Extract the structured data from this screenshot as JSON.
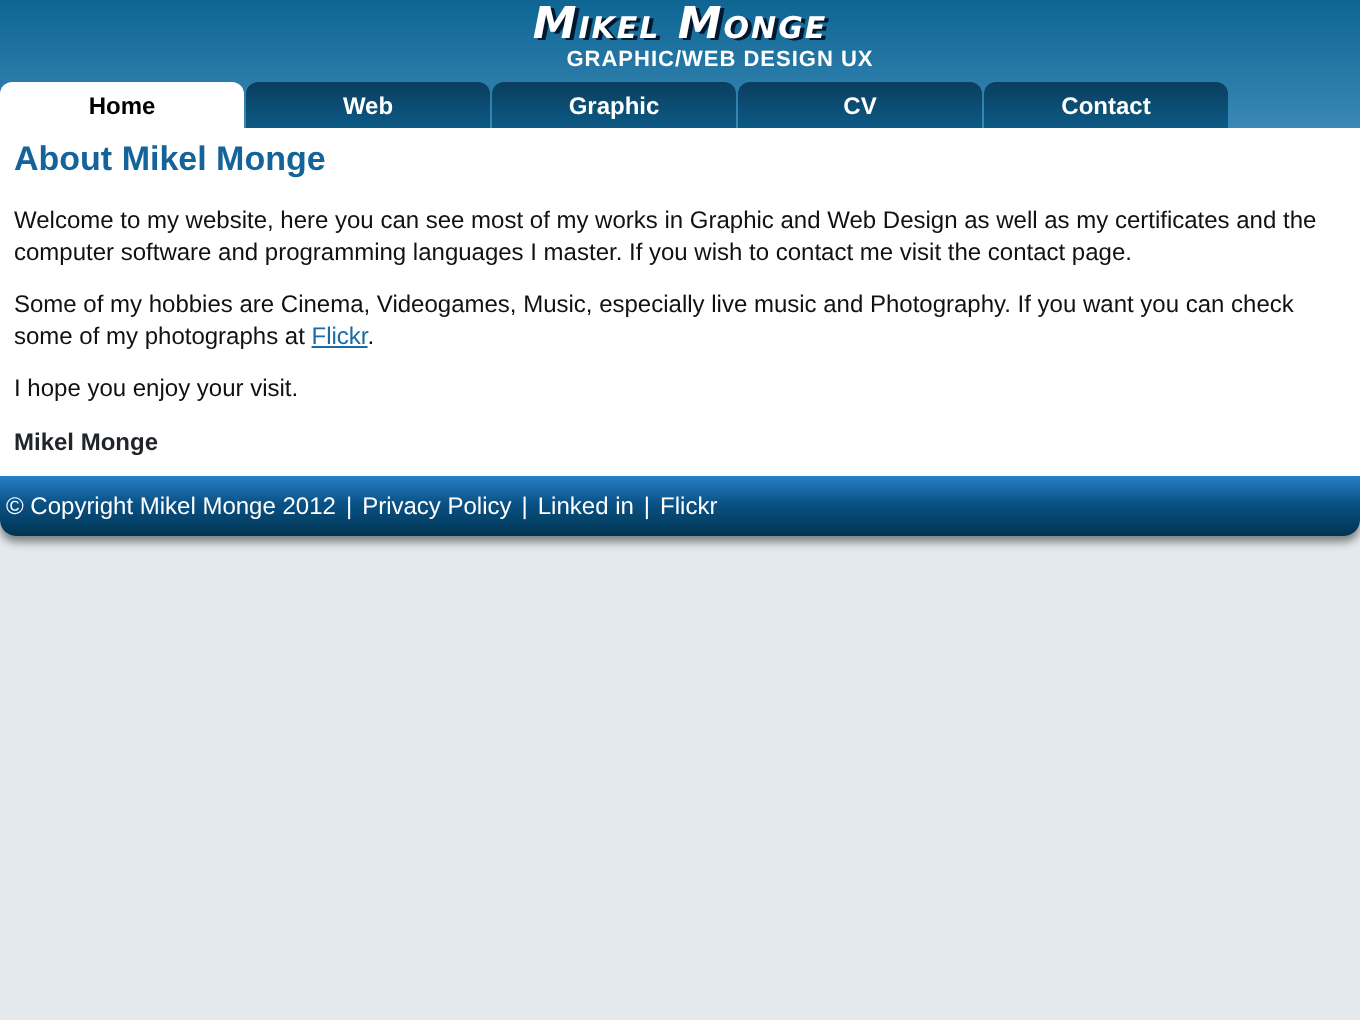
{
  "header": {
    "logo": "Mikel Monge",
    "tagline": "GRAPHIC/WEB DESIGN UX"
  },
  "tabs": [
    {
      "label": "Home",
      "selected": true
    },
    {
      "label": "Web",
      "selected": false
    },
    {
      "label": "Graphic",
      "selected": false
    },
    {
      "label": "CV",
      "selected": false
    },
    {
      "label": "Contact",
      "selected": false
    }
  ],
  "content": {
    "heading": "About Mikel Monge",
    "paragraphs": [
      {
        "text": "Welcome to my website, here you can see most of my works in Graphic and Web Design as well as my certificates and the computer software and programming languages I master. If you wish to contact me visit the contact page."
      },
      {
        "text": "Some of my hobbies are Cinema, Videogames, Music, especially live music and Photography. If you want you can check some of my photographs at",
        "link": "Flickr",
        "after": "."
      },
      {
        "text": "I hope you enjoy your visit."
      }
    ],
    "signature": "Mikel Monge"
  },
  "footer": {
    "copyright": "© Copyright Mikel Monge 2012",
    "separator": "|",
    "links": [
      "Privacy Policy",
      "Linked in",
      "Flickr"
    ]
  }
}
